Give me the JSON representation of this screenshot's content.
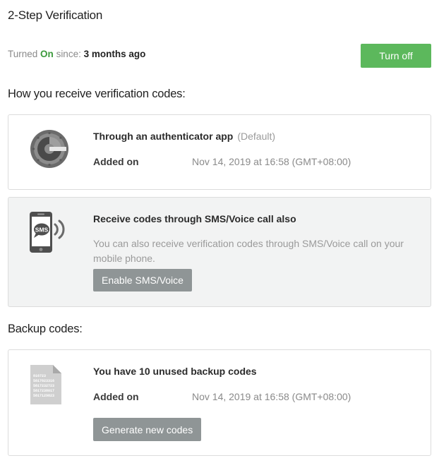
{
  "page": {
    "title": "2-Step Verification"
  },
  "status": {
    "prefix": "Turned",
    "state": "On",
    "since_label": "since:",
    "since_value": "3 months ago",
    "turn_off_label": "Turn off"
  },
  "receive": {
    "heading": "How you receive verification codes:",
    "authenticator": {
      "title": "Through an authenticator app",
      "tag": "(Default)",
      "added_label": "Added on",
      "added_value": "Nov 14, 2019 at 16:58 (GMT+08:00)",
      "icon": "authenticator-app-icon"
    },
    "sms": {
      "title": "Receive codes through SMS/Voice call also",
      "description": "You can also receive verification codes through SMS/Voice call on your mobile phone.",
      "button_label": "Enable SMS/Voice",
      "icon": "sms-phone-icon",
      "icon_text": "SMS"
    }
  },
  "backup": {
    "heading": "Backup codes:",
    "title": "You have 10 unused backup codes",
    "added_label": "Added on",
    "added_value": "Nov 14, 2019 at 16:58 (GMT+08:00)",
    "button_label": "Generate new codes",
    "icon": "backup-codes-document-icon",
    "icon_codes": [
      "816723",
      "5817823316",
      "5817232723",
      "5817238017",
      "5817129823"
    ]
  },
  "colors": {
    "primary_green": "#5cb85c",
    "on_green": "#3c9a3c",
    "gray_button": "#8f9596",
    "card_border": "#dcdcdc",
    "gray_card_bg": "#f2f3f3"
  }
}
